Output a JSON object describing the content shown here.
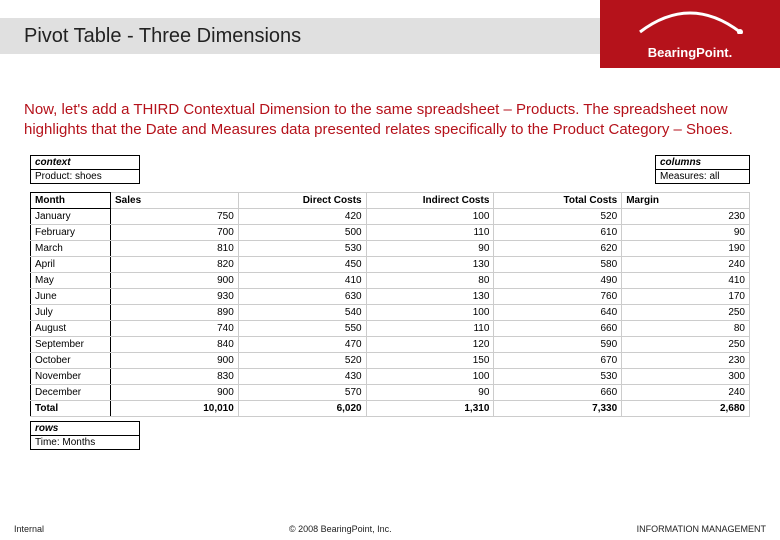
{
  "header": {
    "title": "Pivot Table - Three Dimensions",
    "brand": "BearingPoint."
  },
  "description": "Now, let's add a THIRD Contextual Dimension to the same spreadsheet – Products. The spreadsheet now highlights that the Date and Measures data presented relates specifically to the Product Category – Shoes.",
  "context": {
    "label": "context",
    "value": "Product: shoes"
  },
  "columns_meta": {
    "label": "columns",
    "value": "Measures: all"
  },
  "rows_meta": {
    "label": "rows",
    "value": "Time: Months"
  },
  "table": {
    "headers": [
      "Month",
      "Sales",
      "Direct Costs",
      "Indirect Costs",
      "Total Costs",
      "Margin"
    ],
    "rows": [
      {
        "month": "January",
        "sales": "750",
        "direct": "420",
        "indirect": "100",
        "total": "520",
        "margin": "230"
      },
      {
        "month": "February",
        "sales": "700",
        "direct": "500",
        "indirect": "110",
        "total": "610",
        "margin": "90"
      },
      {
        "month": "March",
        "sales": "810",
        "direct": "530",
        "indirect": "90",
        "total": "620",
        "margin": "190"
      },
      {
        "month": "April",
        "sales": "820",
        "direct": "450",
        "indirect": "130",
        "total": "580",
        "margin": "240"
      },
      {
        "month": "May",
        "sales": "900",
        "direct": "410",
        "indirect": "80",
        "total": "490",
        "margin": "410"
      },
      {
        "month": "June",
        "sales": "930",
        "direct": "630",
        "indirect": "130",
        "total": "760",
        "margin": "170"
      },
      {
        "month": "July",
        "sales": "890",
        "direct": "540",
        "indirect": "100",
        "total": "640",
        "margin": "250"
      },
      {
        "month": "August",
        "sales": "740",
        "direct": "550",
        "indirect": "110",
        "total": "660",
        "margin": "80"
      },
      {
        "month": "September",
        "sales": "840",
        "direct": "470",
        "indirect": "120",
        "total": "590",
        "margin": "250"
      },
      {
        "month": "October",
        "sales": "900",
        "direct": "520",
        "indirect": "150",
        "total": "670",
        "margin": "230"
      },
      {
        "month": "November",
        "sales": "830",
        "direct": "430",
        "indirect": "100",
        "total": "530",
        "margin": "300"
      },
      {
        "month": "December",
        "sales": "900",
        "direct": "570",
        "indirect": "90",
        "total": "660",
        "margin": "240"
      }
    ],
    "total": {
      "month": "Total",
      "sales": "10,010",
      "direct": "6,020",
      "indirect": "1,310",
      "total": "7,330",
      "margin": "2,680"
    }
  },
  "footer": {
    "left": "Internal",
    "center": "© 2008 BearingPoint, Inc.",
    "right": "INFORMATION MANAGEMENT"
  }
}
